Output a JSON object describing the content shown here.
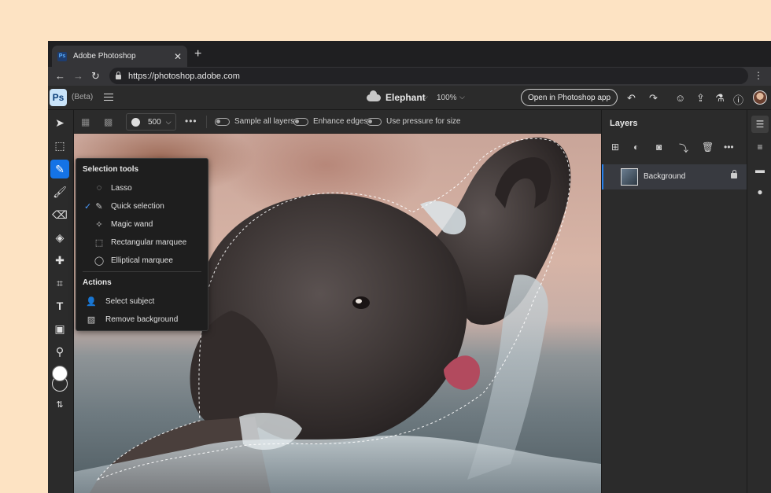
{
  "browser": {
    "tab_title": "Adobe Photoshop",
    "favicon": "Ps",
    "close_glyph": "✕",
    "new_tab_glyph": "+",
    "url": "https://photoshop.adobe.com",
    "menu_glyph": "⋮"
  },
  "header": {
    "logo": "Ps",
    "beta": "(Beta)",
    "doc_name": "Elephant",
    "zoom": "100%",
    "open_button": "Open in Photoshop app"
  },
  "options": {
    "brush_size": "500",
    "sample_all_layers": "Sample all layers",
    "enhance_edges": "Enhance edges",
    "use_pressure": "Use pressure for size"
  },
  "layers": {
    "title": "Layers",
    "items": [
      {
        "name": "Background"
      }
    ]
  },
  "flyout": {
    "selection_title": "Selection tools",
    "selection_items": [
      {
        "label": "Lasso",
        "icon": "lasso-icon"
      },
      {
        "label": "Quick selection",
        "icon": "quick-selection-icon",
        "selected": true
      },
      {
        "label": "Magic wand",
        "icon": "magic-wand-icon"
      },
      {
        "label": "Rectangular marquee",
        "icon": "rectangular-marquee-icon"
      },
      {
        "label": "Elliptical marquee",
        "icon": "elliptical-marquee-icon"
      }
    ],
    "actions_title": "Actions",
    "action_items": [
      {
        "label": "Select subject",
        "icon": "select-subject-icon"
      },
      {
        "label": "Remove background",
        "icon": "remove-background-icon"
      }
    ]
  },
  "colors": {
    "accent": "#1473e6",
    "foreground_color": "#ffffff"
  }
}
